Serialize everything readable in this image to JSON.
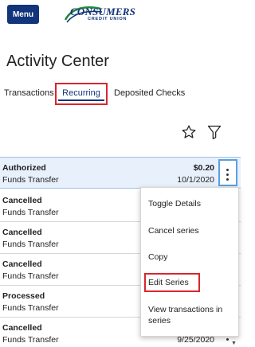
{
  "header": {
    "menu_label": "Menu",
    "logo_name": "CONSUMERS",
    "logo_sub": "CREDIT UNION"
  },
  "page": {
    "title": "Activity Center"
  },
  "tabs": [
    {
      "label": "Transactions",
      "active": false
    },
    {
      "label": "Recurring",
      "active": true
    },
    {
      "label": "Deposited Checks",
      "active": false
    }
  ],
  "rows": [
    {
      "status": "Authorized",
      "type": "Funds Transfer",
      "amount": "$0.20",
      "date": "10/1/2020",
      "selected": true
    },
    {
      "status": "Cancelled",
      "type": "Funds Transfer",
      "amount": "",
      "date": ""
    },
    {
      "status": "Cancelled",
      "type": "Funds Transfer",
      "amount": "",
      "date": ""
    },
    {
      "status": "Cancelled",
      "type": "Funds Transfer",
      "amount": "",
      "date": ""
    },
    {
      "status": "Processed",
      "type": "Funds Transfer",
      "amount": "",
      "date": ""
    },
    {
      "status": "Cancelled",
      "type": "Funds Transfer",
      "amount": "",
      "date": "9/25/2020"
    }
  ],
  "context_menu": {
    "items": [
      "Toggle Details",
      "Cancel series",
      "Copy",
      "Edit Series",
      "View transactions in series"
    ]
  },
  "colors": {
    "brand": "#12347a",
    "highlight": "#d9262e",
    "selected_row": "#e8f0fb",
    "kebab_focus": "#5aa0e0"
  }
}
